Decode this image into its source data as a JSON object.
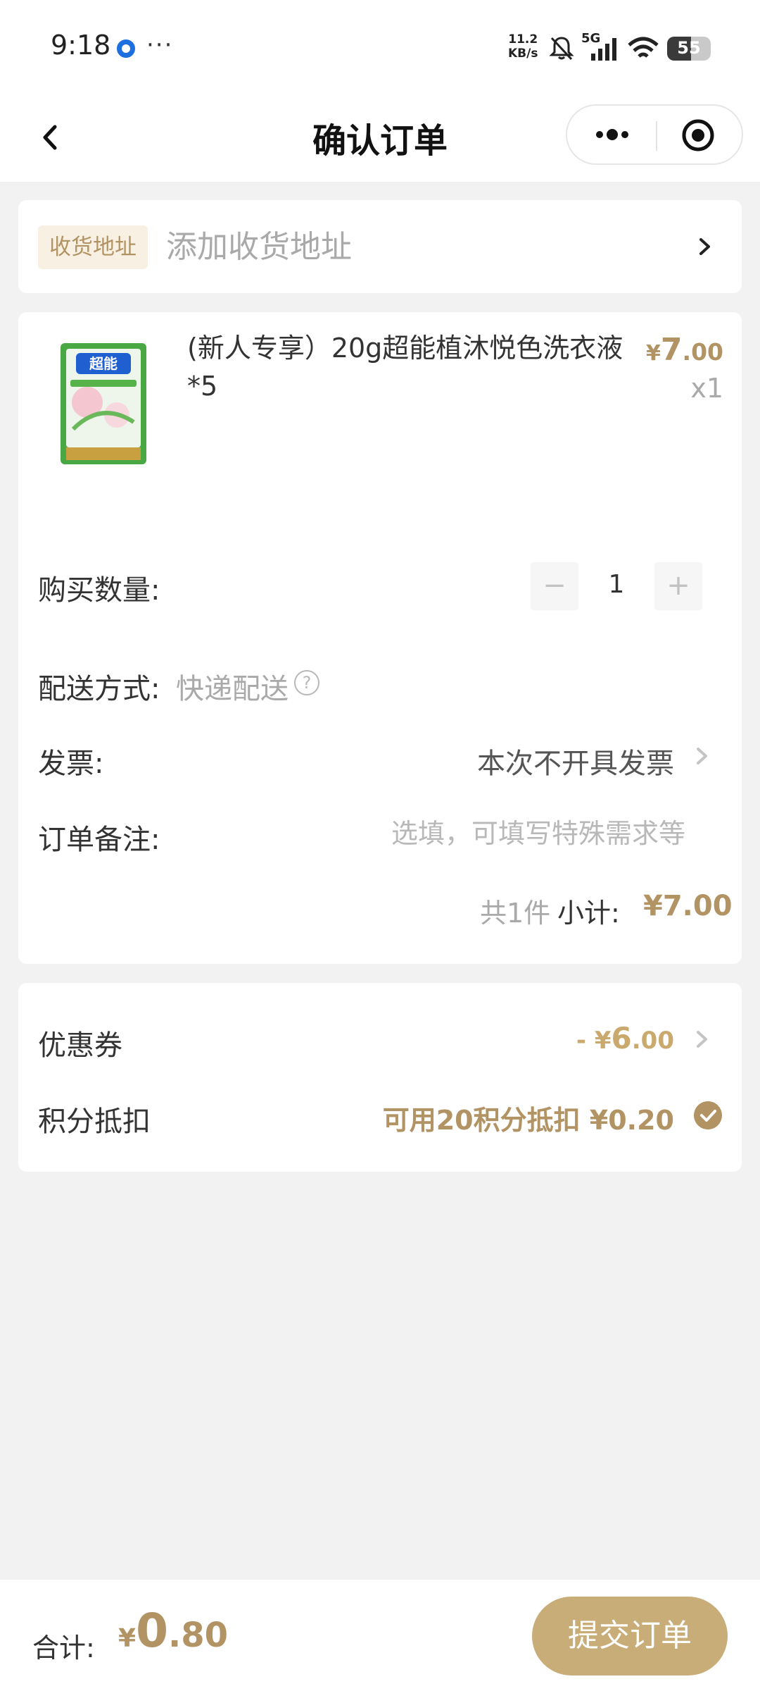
{
  "status_bar": {
    "time": "9:18",
    "more": "···",
    "net_speed_value": "11.2",
    "net_speed_unit": "KB/s",
    "network": "5G",
    "battery": "55",
    "battery_level": 0.55,
    "icons": [
      "bell-muted-icon",
      "signal-icon",
      "wifi-icon",
      "battery-icon"
    ]
  },
  "nav": {
    "title": "确认订单",
    "icons": [
      "back-icon",
      "more-dots-icon",
      "target-icon"
    ]
  },
  "address": {
    "tag": "收货地址",
    "placeholder": "添加收货地址"
  },
  "product": {
    "title": "(新人专享）20g超能植沐悦色洗衣液*5",
    "price_currency": "¥",
    "price_int": "7",
    "price_dec": ".00",
    "qty": "x1",
    "image_brand": "超能"
  },
  "purchase_qty": {
    "label": "购买数量:",
    "minus": "−",
    "value": "1",
    "plus": "+"
  },
  "delivery": {
    "label": "配送方式:",
    "value": "快递配送",
    "help": "?"
  },
  "invoice": {
    "label": "发票:",
    "value": "本次不开具发票"
  },
  "remark": {
    "label": "订单备注:",
    "placeholder": "选填，可填写特殊需求等"
  },
  "summary": {
    "count": "共1件",
    "subtotal_label": "小计:",
    "subtotal": "¥7.00"
  },
  "coupon": {
    "label": "优惠券",
    "prefix": "- ¥",
    "int": "6",
    "dec": ".00"
  },
  "points": {
    "label": "积分抵扣",
    "text": "可用20积分抵扣 ¥0.20",
    "checked": true
  },
  "footer": {
    "total_label": "合计:",
    "total_currency": "¥",
    "total_int": "0",
    "total_dec": ".80",
    "submit": "提交订单"
  },
  "colors": {
    "accent": "#b29363",
    "button": "#c9ad78",
    "page_bg": "#f2f2f2"
  }
}
